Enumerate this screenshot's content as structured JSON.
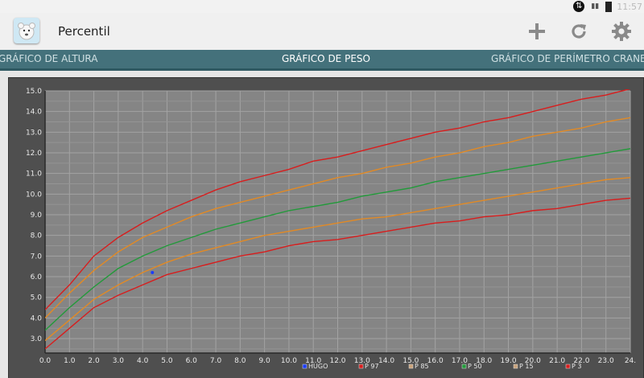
{
  "status_bar": {
    "time": "11:57",
    "icons": [
      "data-icon",
      "signal-icon",
      "battery-charging-icon"
    ]
  },
  "action_bar": {
    "title": "Percentil",
    "app_icon": "bear-app-icon",
    "actions": [
      {
        "name": "add-icon",
        "glyph": "+"
      },
      {
        "name": "refresh-icon",
        "glyph": "refresh"
      },
      {
        "name": "settings-icon",
        "glyph": "gear"
      }
    ]
  },
  "tabs": [
    {
      "label": "GRÁFICO DE ALTURA",
      "active": false
    },
    {
      "label": "GRÁFICO DE PESO",
      "active": true
    },
    {
      "label": "GRÁFICO DE PERÍMETRO CRANEAL",
      "active": false
    }
  ],
  "colors": {
    "tab_bar": "#44717b",
    "plot_bg": "#858585",
    "frame_bg": "#4f4f4f",
    "p97": "#d81d1d",
    "p85": "#e28a25",
    "p50": "#229a3a",
    "p15": "#e28a25",
    "p3": "#d81d1d",
    "hugo": "#1a3cff"
  },
  "chart_data": {
    "type": "line",
    "grid": true,
    "xlim": [
      0,
      24
    ],
    "ylim": [
      2.3,
      15.0
    ],
    "x_ticks": [
      "0.0",
      "1.0",
      "2.0",
      "3.0",
      "4.0",
      "5.0",
      "6.0",
      "7.0",
      "8.0",
      "9.0",
      "10.0",
      "11.0",
      "12.0",
      "13.0",
      "14.0",
      "15.0",
      "16.0",
      "17.0",
      "18.0",
      "19.0",
      "20.0",
      "21.0",
      "22.0",
      "23.0",
      "24."
    ],
    "y_ticks": [
      "3.0",
      "4.0",
      "5.0",
      "6.0",
      "7.0",
      "8.0",
      "9.0",
      "10.0",
      "11.0",
      "12.0",
      "13.0",
      "14.0",
      "15.0"
    ],
    "x": [
      0,
      1,
      2,
      3,
      4,
      5,
      6,
      7,
      8,
      9,
      10,
      11,
      12,
      13,
      14,
      15,
      16,
      17,
      18,
      19,
      20,
      21,
      22,
      23,
      24
    ],
    "series": [
      {
        "name": "P 97",
        "color": "#d81d1d",
        "values": [
          4.4,
          5.6,
          7.0,
          7.9,
          8.6,
          9.2,
          9.7,
          10.2,
          10.6,
          10.9,
          11.2,
          11.6,
          11.8,
          12.1,
          12.4,
          12.7,
          13.0,
          13.2,
          13.5,
          13.7,
          14.0,
          14.3,
          14.6,
          14.8,
          15.1
        ]
      },
      {
        "name": "P 85",
        "color": "#e28a25",
        "values": [
          4.0,
          5.2,
          6.3,
          7.2,
          7.9,
          8.4,
          8.9,
          9.3,
          9.6,
          9.9,
          10.2,
          10.5,
          10.8,
          11.0,
          11.3,
          11.5,
          11.8,
          12.0,
          12.3,
          12.5,
          12.8,
          13.0,
          13.2,
          13.5,
          13.7
        ]
      },
      {
        "name": "P 50",
        "color": "#229a3a",
        "values": [
          3.4,
          4.5,
          5.5,
          6.4,
          7.0,
          7.5,
          7.9,
          8.3,
          8.6,
          8.9,
          9.2,
          9.4,
          9.6,
          9.9,
          10.1,
          10.3,
          10.6,
          10.8,
          11.0,
          11.2,
          11.4,
          11.6,
          11.8,
          12.0,
          12.2
        ]
      },
      {
        "name": "P 15",
        "color": "#e28a25",
        "values": [
          2.9,
          3.9,
          4.9,
          5.6,
          6.2,
          6.7,
          7.1,
          7.4,
          7.7,
          8.0,
          8.2,
          8.4,
          8.6,
          8.8,
          8.9,
          9.1,
          9.3,
          9.5,
          9.7,
          9.9,
          10.1,
          10.3,
          10.5,
          10.7,
          10.8
        ]
      },
      {
        "name": "P 3",
        "color": "#d81d1d",
        "values": [
          2.5,
          3.5,
          4.5,
          5.1,
          5.6,
          6.1,
          6.4,
          6.7,
          7.0,
          7.2,
          7.5,
          7.7,
          7.8,
          8.0,
          8.2,
          8.4,
          8.6,
          8.7,
          8.9,
          9.0,
          9.2,
          9.3,
          9.5,
          9.7,
          9.8
        ]
      }
    ],
    "points": [
      {
        "name": "HUGO",
        "color": "#1a3cff",
        "x": 4.4,
        "y": 6.2
      }
    ],
    "legend": [
      {
        "label": "HUGO",
        "color": "#1a3cff"
      },
      {
        "label": "P 97",
        "color": "#d81d1d"
      },
      {
        "label": "P 85",
        "color": "#c9a27a"
      },
      {
        "label": "P 50",
        "color": "#229a3a"
      },
      {
        "label": "P 15",
        "color": "#c9a27a"
      },
      {
        "label": "P 3",
        "color": "#d81d1d"
      }
    ],
    "legend_position": "bottom"
  }
}
